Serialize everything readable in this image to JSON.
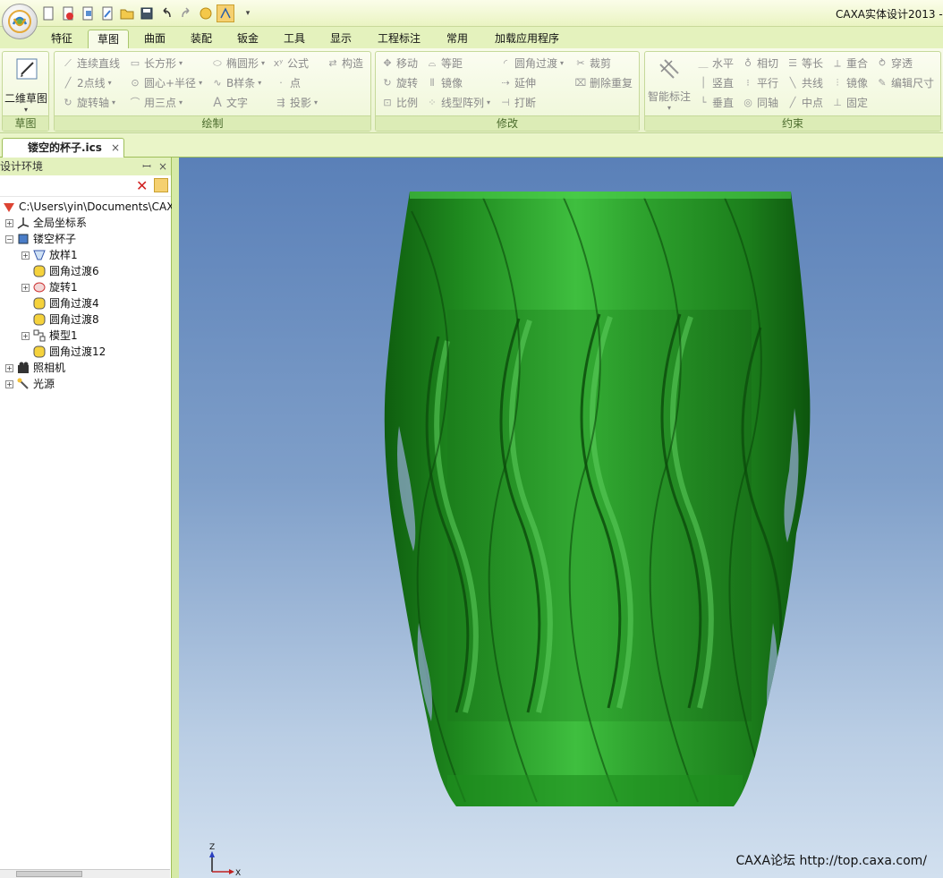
{
  "app": {
    "title": "CAXA实体设计2013 -"
  },
  "tabs": [
    "特征",
    "草图",
    "曲面",
    "装配",
    "钣金",
    "工具",
    "显示",
    "工程标注",
    "常用",
    "加载应用程序"
  ],
  "active_tab": "草图",
  "ribbon": {
    "sketch_group": {
      "label": "草图",
      "big_button": "二维草图"
    },
    "draw_group": {
      "label": "绘制",
      "items": [
        "连续直线",
        "长方形",
        "椭圆形",
        "公式",
        "构造",
        "2点线",
        "圆心+半径",
        "B样条",
        "点",
        "旋转轴",
        "用三点",
        "文字",
        "投影"
      ]
    },
    "modify_group": {
      "label": "修改",
      "items": [
        "移动",
        "等距",
        "圆角过渡",
        "裁剪",
        "旋转",
        "镜像",
        "延伸",
        "删除重复",
        "比例",
        "线型阵列",
        "打断"
      ]
    },
    "constraint_group": {
      "label": "约束",
      "big_button": "智能标注",
      "items": [
        "水平",
        "相切",
        "等长",
        "重合",
        "穿透",
        "竖直",
        "平行",
        "共线",
        "镜像",
        "编辑尺寸",
        "垂直",
        "同轴",
        "中点",
        "固定"
      ]
    }
  },
  "document_tab": {
    "label": "镂空的杯子.ics"
  },
  "panel": {
    "title": "设计环境",
    "tree": {
      "root": "C:\\Users\\yin\\Documents\\CAX",
      "items": [
        "全局坐标系",
        "镂空杯子",
        "放样1",
        "圆角过渡6",
        "旋转1",
        "圆角过渡4",
        "圆角过渡8",
        "模型1",
        "圆角过渡12",
        "照相机",
        "光源"
      ]
    }
  },
  "viewport": {
    "watermark": "CAXA论坛 http://top.caxa.com/",
    "triad": {
      "z": "Z",
      "x": "X"
    },
    "model_color": "#2a9a2a"
  }
}
